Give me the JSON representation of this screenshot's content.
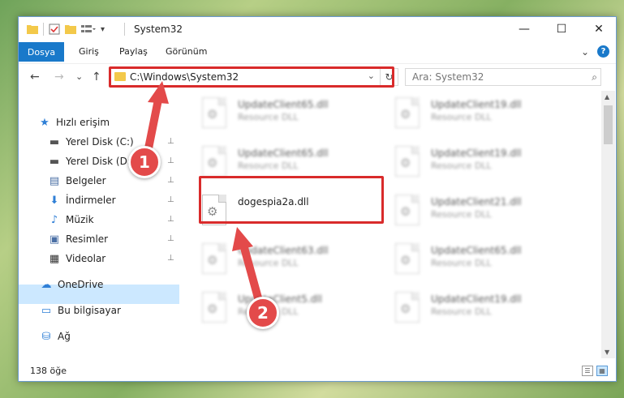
{
  "window": {
    "title": "System32",
    "minimize": "—",
    "maximize": "☐",
    "close": "✕"
  },
  "ribbon": {
    "file_tab": "Dosya",
    "tabs": [
      "Giriş",
      "Paylaş",
      "Görünüm"
    ],
    "help": "?",
    "collapse": "⌄"
  },
  "nav": {
    "back": "←",
    "forward": "→",
    "recent": "⌄",
    "up": "↑",
    "address": "C:\\Windows\\System32",
    "refresh": "↻",
    "search_placeholder": "Ara: System32"
  },
  "sidebar": {
    "items": [
      {
        "label": "Hızlı erişim",
        "icon": "star-icon",
        "glyph": "★",
        "color": "#2f7fd6",
        "pinned": false
      },
      {
        "label": "Yerel Disk (C:)",
        "icon": "drive-icon",
        "glyph": "▬",
        "color": "#555555",
        "pinned": true
      },
      {
        "label": "Yerel Disk (D:)",
        "icon": "drive-icon",
        "glyph": "▬",
        "color": "#555555",
        "pinned": true
      },
      {
        "label": "Belgeler",
        "icon": "documents-icon",
        "glyph": "▤",
        "color": "#4a6fa5",
        "pinned": true
      },
      {
        "label": "İndirmeler",
        "icon": "download-icon",
        "glyph": "⬇",
        "color": "#2f7fd6",
        "pinned": true
      },
      {
        "label": "Müzik",
        "icon": "music-icon",
        "glyph": "♪",
        "color": "#2f7fd6",
        "pinned": true
      },
      {
        "label": "Resimler",
        "icon": "pictures-icon",
        "glyph": "▣",
        "color": "#4a6fa5",
        "pinned": true
      },
      {
        "label": "Videolar",
        "icon": "videos-icon",
        "glyph": "▦",
        "color": "#333333",
        "pinned": true
      },
      {
        "label": "OneDrive",
        "icon": "cloud-icon",
        "glyph": "☁",
        "color": "#2f7fd6",
        "pinned": false
      },
      {
        "label": "Bu bilgisayar",
        "icon": "computer-icon",
        "glyph": "▭",
        "color": "#2f7fd6",
        "pinned": false
      },
      {
        "label": "Ağ",
        "icon": "network-icon",
        "glyph": "⛁",
        "color": "#2f7fd6",
        "pinned": false
      }
    ],
    "pin_glyph": "📌"
  },
  "files": {
    "left_column": [
      {
        "name": "UpdateClient65.dll",
        "desc": "Resource DLL",
        "blurred": true
      },
      {
        "name": "UpdateClient65.dll",
        "desc": "Resource DLL",
        "blurred": true
      },
      {
        "name": "dogespia2a.dll",
        "desc": "",
        "blurred": false
      },
      {
        "name": "UpdateClient63.dll",
        "desc": "Resource DLL",
        "blurred": true
      },
      {
        "name": "UpdateClient5.dll",
        "desc": "Resource DLL",
        "blurred": true
      }
    ],
    "right_column": [
      {
        "name": "UpdateClient19.dll",
        "desc": "Resource DLL",
        "blurred": true
      },
      {
        "name": "UpdateClient19.dll",
        "desc": "Resource DLL",
        "blurred": true
      },
      {
        "name": "UpdateClient21.dll",
        "desc": "Resource DLL",
        "blurred": true
      },
      {
        "name": "UpdateClient65.dll",
        "desc": "Resource DLL",
        "blurred": true
      },
      {
        "name": "UpdateClient19.dll",
        "desc": "Resource DLL",
        "blurred": true
      }
    ]
  },
  "status": {
    "count": "138 öğe"
  },
  "callouts": [
    "1",
    "2"
  ],
  "colors": {
    "accent": "#1979ca",
    "highlight": "#d92b2b",
    "callout": "#e34a4a"
  }
}
